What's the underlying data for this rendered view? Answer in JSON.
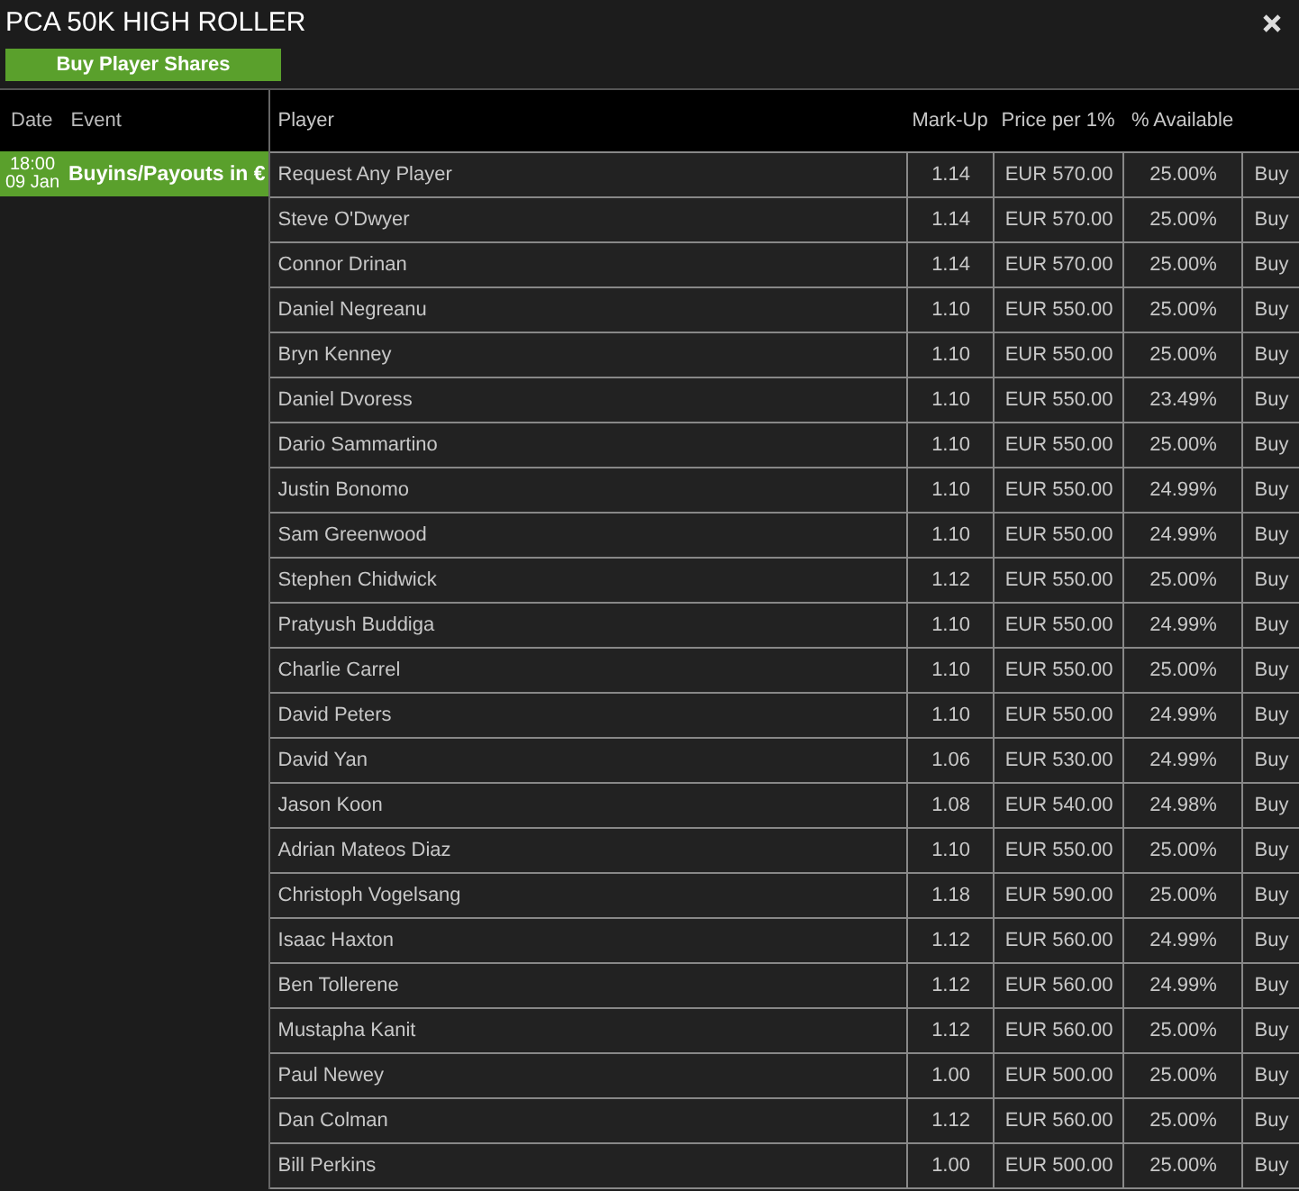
{
  "window": {
    "title": "PCA 50K HIGH ROLLER"
  },
  "action_button": "Buy Player Shares",
  "events": {
    "columns": [
      "Date",
      "Event"
    ],
    "rows": [
      {
        "time": "18:00",
        "date": "09 Jan",
        "event": "Buyins/Payouts in €",
        "selected": true
      }
    ]
  },
  "players": {
    "columns": [
      "Player",
      "Mark-Up",
      "Price per 1%",
      "% Available"
    ],
    "rows": [
      {
        "player": "Request Any Player",
        "markup": "1.14",
        "price": "EUR 570.00",
        "available": "25.00%",
        "action": "Buy"
      },
      {
        "player": "Steve O'Dwyer",
        "markup": "1.14",
        "price": "EUR 570.00",
        "available": "25.00%",
        "action": "Buy"
      },
      {
        "player": "Connor Drinan",
        "markup": "1.14",
        "price": "EUR 570.00",
        "available": "25.00%",
        "action": "Buy"
      },
      {
        "player": "Daniel Negreanu",
        "markup": "1.10",
        "price": "EUR 550.00",
        "available": "25.00%",
        "action": "Buy"
      },
      {
        "player": "Bryn Kenney",
        "markup": "1.10",
        "price": "EUR 550.00",
        "available": "25.00%",
        "action": "Buy"
      },
      {
        "player": "Daniel Dvoress",
        "markup": "1.10",
        "price": "EUR 550.00",
        "available": "23.49%",
        "action": "Buy"
      },
      {
        "player": "Dario Sammartino",
        "markup": "1.10",
        "price": "EUR 550.00",
        "available": "25.00%",
        "action": "Buy"
      },
      {
        "player": "Justin Bonomo",
        "markup": "1.10",
        "price": "EUR 550.00",
        "available": "24.99%",
        "action": "Buy"
      },
      {
        "player": "Sam Greenwood",
        "markup": "1.10",
        "price": "EUR 550.00",
        "available": "24.99%",
        "action": "Buy"
      },
      {
        "player": "Stephen Chidwick",
        "markup": "1.12",
        "price": "EUR 550.00",
        "available": "25.00%",
        "action": "Buy"
      },
      {
        "player": "Pratyush Buddiga",
        "markup": "1.10",
        "price": "EUR 550.00",
        "available": "24.99%",
        "action": "Buy"
      },
      {
        "player": "Charlie Carrel",
        "markup": "1.10",
        "price": "EUR 550.00",
        "available": "25.00%",
        "action": "Buy"
      },
      {
        "player": "David Peters",
        "markup": "1.10",
        "price": "EUR 550.00",
        "available": "24.99%",
        "action": "Buy"
      },
      {
        "player": "David Yan",
        "markup": "1.06",
        "price": "EUR 530.00",
        "available": "24.99%",
        "action": "Buy"
      },
      {
        "player": "Jason Koon",
        "markup": "1.08",
        "price": "EUR 540.00",
        "available": "24.98%",
        "action": "Buy"
      },
      {
        "player": "Adrian Mateos Diaz",
        "markup": "1.10",
        "price": "EUR 550.00",
        "available": "25.00%",
        "action": "Buy"
      },
      {
        "player": "Christoph Vogelsang",
        "markup": "1.18",
        "price": "EUR 590.00",
        "available": "25.00%",
        "action": "Buy"
      },
      {
        "player": "Isaac Haxton",
        "markup": "1.12",
        "price": "EUR 560.00",
        "available": "24.99%",
        "action": "Buy"
      },
      {
        "player": "Ben Tollerene",
        "markup": "1.12",
        "price": "EUR 560.00",
        "available": "24.99%",
        "action": "Buy"
      },
      {
        "player": "Mustapha Kanit",
        "markup": "1.12",
        "price": "EUR 560.00",
        "available": "25.00%",
        "action": "Buy"
      },
      {
        "player": "Paul Newey",
        "markup": "1.00",
        "price": "EUR 500.00",
        "available": "25.00%",
        "action": "Buy"
      },
      {
        "player": "Dan Colman",
        "markup": "1.12",
        "price": "EUR 560.00",
        "available": "25.00%",
        "action": "Buy"
      },
      {
        "player": "Bill Perkins",
        "markup": "1.00",
        "price": "EUR 500.00",
        "available": "25.00%",
        "action": "Buy"
      }
    ]
  }
}
